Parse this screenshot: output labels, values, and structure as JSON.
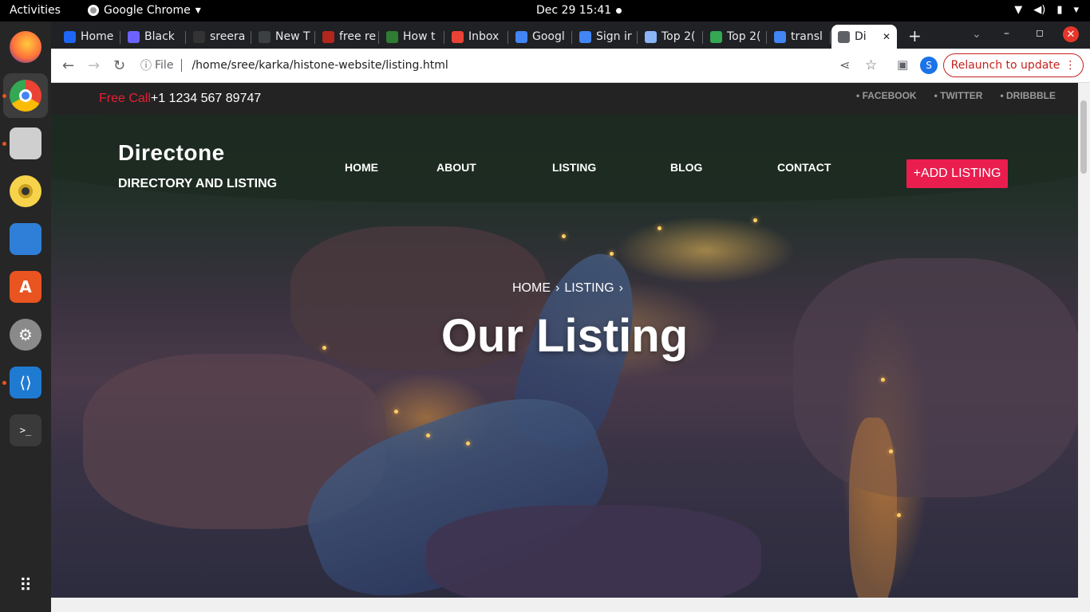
{
  "system": {
    "activities": "Activities",
    "app_name": "Google Chrome",
    "clock": "Dec 29  15:41"
  },
  "tabs": [
    {
      "label": "Home",
      "color": "#1e66f5"
    },
    {
      "label": "Black",
      "color": "#6c63ff"
    },
    {
      "label": "sreera",
      "color": "#333333"
    },
    {
      "label": "New T",
      "color": "#3c4043"
    },
    {
      "label": "free re",
      "color": "#b3261e"
    },
    {
      "label": "How t",
      "color": "#2e7d32"
    },
    {
      "label": "Inbox",
      "color": "#ea4335"
    },
    {
      "label": "Googl",
      "color": "#4285f4"
    },
    {
      "label": "Sign ir",
      "color": "#4285f4"
    },
    {
      "label": "Top 2(",
      "color": "#8ab4f8"
    },
    {
      "label": "Top 2(",
      "color": "#34a853"
    },
    {
      "label": "transl",
      "color": "#4285f4"
    },
    {
      "label": "Di",
      "color": "#5f6368"
    }
  ],
  "toolbar": {
    "file_label": "File",
    "url": "/home/sree/karka/histone-website/listing.html",
    "avatar_letter": "S",
    "relaunch_label": "Relaunch to update"
  },
  "site": {
    "free_call_label": "Free Call",
    "phone": "+1 1234 567 89747",
    "social": [
      "FACEBOOK",
      "TWITTER",
      "DRIBBBLE"
    ],
    "brand_name": "Directone",
    "tagline": "DIRECTORY AND LISTING",
    "nav": [
      "HOME",
      "ABOUT",
      "LISTING",
      "BLOG",
      "CONTACT"
    ],
    "add_listing": "+ADD LISTING",
    "breadcrumb": [
      "HOME",
      "LISTING"
    ],
    "hero_title": "Our Listing",
    "accent_color": "#e91e4f"
  }
}
